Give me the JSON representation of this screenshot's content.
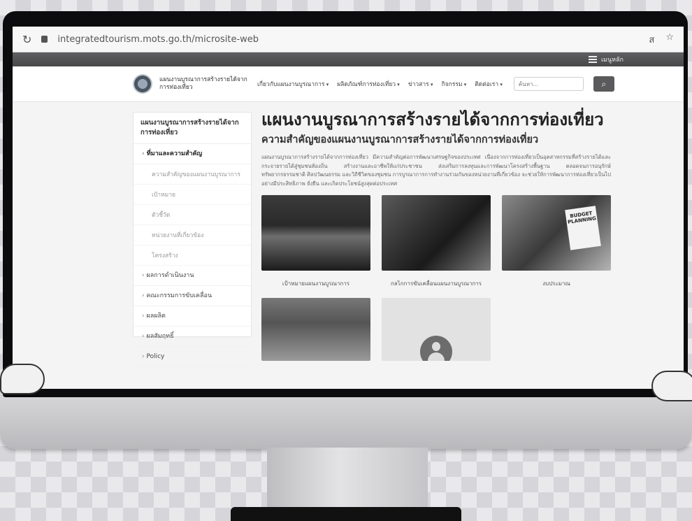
{
  "browser": {
    "url": "integratedtourism.mots.go.th/microsite-web",
    "right_icons": [
      "ส",
      "☆"
    ]
  },
  "topbar": {
    "menu_label": "เมนูหลัก"
  },
  "header": {
    "site_name": "แผนงานบูรณาการสร้างรายได้จากการท่องเที่ยว",
    "nav": [
      "เกี่ยวกับแผนงานบูรณาการ",
      "ผลิตภัณฑ์การท่องเที่ยว",
      "ข่าวสาร",
      "กิจกรรม",
      "ติดต่อเรา"
    ],
    "search_placeholder": "ค้นหา...",
    "search_icon": "search-icon"
  },
  "sidebar": {
    "title": "แผนงานบูรณาการสร้างรายได้จากการท่องเที่ยว",
    "items": [
      {
        "label": "ที่มาและความสำคัญ",
        "active": true
      },
      {
        "label": "ความสำคัญของแผนงานบูรณาการ",
        "sub": true
      },
      {
        "label": "เป้าหมาย",
        "sub": true
      },
      {
        "label": "ตัวชี้วัด",
        "sub": true
      },
      {
        "label": "หน่วยงานที่เกี่ยวข้อง",
        "sub": true
      },
      {
        "label": "โครงสร้าง",
        "sub": true
      },
      {
        "label": "ผลการดำเนินงาน"
      },
      {
        "label": "คณะกรรมการขับเคลื่อน"
      },
      {
        "label": "ผลผลิต"
      },
      {
        "label": "ผลสัมฤทธิ์"
      },
      {
        "label": "Policy"
      }
    ]
  },
  "main": {
    "title": "แผนงานบูรณาการสร้างรายได้จากการท่องเที่ยว",
    "subtitle": "ความสำคัญของแผนงานบูรณาการสร้างรายได้จากการท่องเที่ยว",
    "paragraph": "แผนงานบูรณาการสร้างรายได้จากการท่องเที่ยว มีความสำคัญต่อการพัฒนาเศรษฐกิจของประเทศ เนื่องจากการท่องเที่ยวเป็นอุตสาหกรรมที่สร้างรายได้และกระจายรายได้สู่ชุมชนท้องถิ่น สร้างงานและอาชีพให้แก่ประชาชน ส่งเสริมการลงทุนและการพัฒนาโครงสร้างพื้นฐาน ตลอดจนการอนุรักษ์ทรัพยากรธรรมชาติ ศิลปวัฒนธรรม และวิถีชีวิตของชุมชน การบูรณาการการทำงานร่วมกันของหน่วยงานที่เกี่ยวข้อง จะช่วยให้การพัฒนาการท่องเที่ยวเป็นไปอย่างมีประสิทธิภาพ ยั่งยืน และเกิดประโยชน์สูงสุดต่อประเทศ",
    "cards": [
      {
        "caption": "เป้าหมายแผนงานบูรณาการ",
        "image": "beach-photo"
      },
      {
        "caption": "กลไกการขับเคลื่อนแผนงานบูรณาการ",
        "image": "meeting-photo"
      },
      {
        "caption": "งบประมาณ",
        "image": "budget-photo",
        "note": "BUDGET PLANNING"
      }
    ],
    "cards_row2": [
      {
        "image": "people-photo"
      },
      {
        "image": "avatar-placeholder"
      }
    ]
  }
}
